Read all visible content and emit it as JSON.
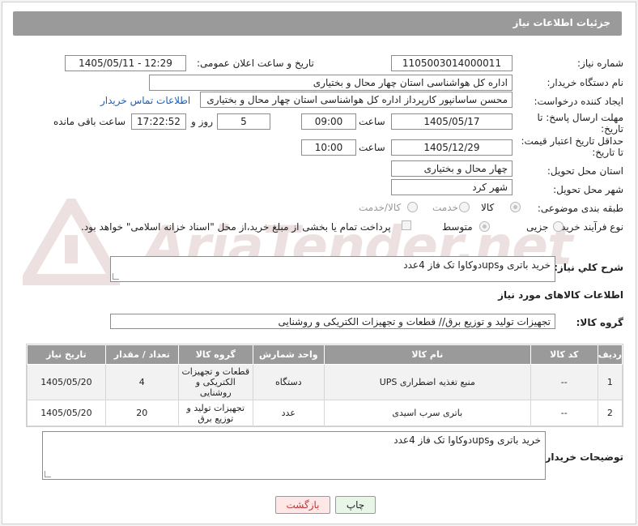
{
  "header": {
    "title": "جزئیات اطلاعات نیاز"
  },
  "watermark": {
    "text": "AriaTender.net"
  },
  "form": {
    "need_number_label": "شماره نیاز:",
    "need_number": "1105003014000011",
    "announce_label": "تاریخ و ساعت اعلان عمومی:",
    "announce_value": "1405/05/11 - 12:29",
    "buyer_org_label": "نام دستگاه خریدار:",
    "buyer_org": "اداره کل هواشناسی استان چهار محال و بختیاری",
    "requester_label": "ایجاد کننده درخواست:",
    "requester": "محسن ساسانپور کارپرداز اداره کل هواشناسی استان چهار محال و بختیاری",
    "contact_link": "اطلاعات تماس خریدار",
    "deadline_label_1": "مهلت ارسال پاسخ: تا",
    "deadline_label_2": "تاریخ:",
    "deadline_date": "1405/05/17",
    "time_label": "ساعت",
    "deadline_time": "09:00",
    "days_value": "5",
    "days_label": "روز و",
    "remaining_time": "17:22:52",
    "remaining_label": "ساعت باقی مانده",
    "price_validity_label_1": "حداقل تاریخ اعتبار قیمت:",
    "price_validity_label_2": "تا تاریخ:",
    "price_validity_date": "1405/12/29",
    "price_validity_time": "10:00",
    "province_label": "استان محل تحویل:",
    "province": "چهار محال و بختیاری",
    "city_label": "شهر محل تحویل:",
    "city": "شهر کرد",
    "category_label": "طبقه بندی موضوعی:",
    "category_options": [
      "کالا",
      "خدمت",
      "کالا/خدمت"
    ],
    "process_label": "نوع فرآیند خرید :",
    "process_options": [
      "جزیی",
      "متوسط"
    ],
    "payment_note": "پرداخت تمام یا بخشی از مبلغ خرید،از محل \"اسناد خزانه اسلامی\" خواهد بود.",
    "summary_label": "شرح کلي نياز:",
    "summary": "خرید باتری وupsدوکاوا تک فاز 4عدد",
    "goods_info_title": "اطلاعات کالاهای مورد نیاز",
    "goods_group_label": "گروه کالا:",
    "goods_group": "تجهیزات تولید و توزیع برق// قطعات و تجهیزات الکتریکی و روشنایی",
    "buyer_notes_label": "توضیحات خریدار:",
    "buyer_notes": "خرید باتری وupsدوکاوا تک فاز 4عدد"
  },
  "table": {
    "headers": [
      "ردیف",
      "کد کالا",
      "نام کالا",
      "واحد شمارش",
      "گروه کالا",
      "تعداد / مقدار",
      "تاریخ نیاز"
    ],
    "rows": [
      [
        "1",
        "--",
        "منبع تغذیه اضطراری UPS",
        "دستگاه",
        "قطعات و تجهیزات الکتریکی و روشنایی",
        "4",
        "1405/05/20"
      ],
      [
        "2",
        "--",
        "باتری سرب اسیدی",
        "عدد",
        "تجهیزات تولید و توزیع برق",
        "20",
        "1405/05/20"
      ]
    ]
  },
  "buttons": {
    "print": "چاپ",
    "back": "بازگشت"
  }
}
